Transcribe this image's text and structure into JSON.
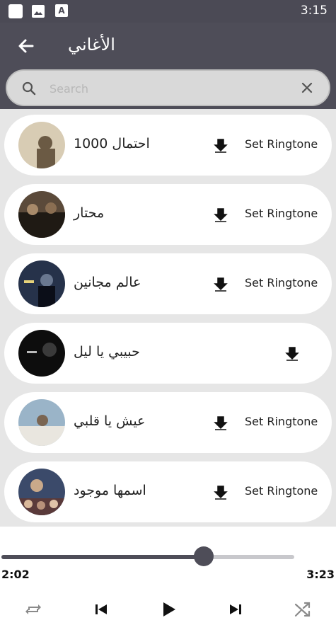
{
  "status_bar": {
    "time": "3:15",
    "a_icon": "A"
  },
  "header": {
    "title": "الأغاني",
    "back_icon": "arrow-left-icon"
  },
  "search": {
    "placeholder": "Search",
    "value": ""
  },
  "songs": [
    {
      "title": "احتمال 1000",
      "ringtone_label": "Set Ringtone",
      "thumb_colors": [
        "#d8ccb4",
        "#6b5a44"
      ]
    },
    {
      "title": "محتار",
      "ringtone_label": "Set Ringtone",
      "thumb_colors": [
        "#5b4a3a",
        "#1f1a14"
      ]
    },
    {
      "title": "عالم مجانين",
      "ringtone_label": "Set Ringtone",
      "thumb_colors": [
        "#26324a",
        "#0b0e18"
      ]
    },
    {
      "title": "حبيبي يا ليل",
      "ringtone_label": "",
      "thumb_colors": [
        "#3a3a3a",
        "#0d0d0d"
      ]
    },
    {
      "title": "عيش يا قلبي",
      "ringtone_label": "Set Ringtone",
      "thumb_colors": [
        "#9ab4c8",
        "#e9e6df"
      ]
    },
    {
      "title": "اسمها موجود",
      "ringtone_label": "Set Ringtone",
      "thumb_colors": [
        "#3b4a6a",
        "#c9a98a"
      ]
    }
  ],
  "player": {
    "elapsed": "2:02",
    "total": "3:23",
    "progress": 0.69,
    "controls": [
      "repeat-icon",
      "skip-previous-icon",
      "play-icon",
      "skip-next-icon",
      "shuffle-icon"
    ]
  },
  "colors": {
    "accent": "#4e4d58",
    "card": "#ffffff",
    "background": "#e6e6e6"
  }
}
